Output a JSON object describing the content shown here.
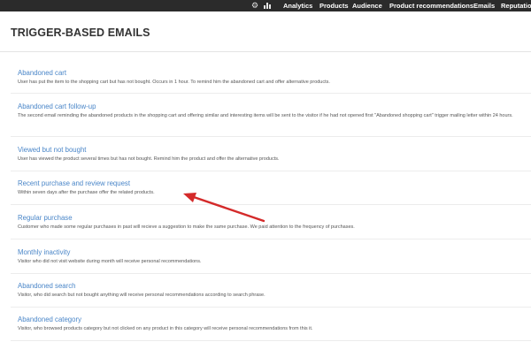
{
  "topbar": {
    "icons": [
      "gear-icon",
      "bar-chart-icon"
    ],
    "nav": [
      "Analytics",
      "Products",
      "Audience",
      "Product recommendations",
      "Emails",
      "Reputation"
    ]
  },
  "page": {
    "title": "TRIGGER-BASED EMAILS"
  },
  "items": [
    {
      "title": "Abandoned cart",
      "description": "User has put the item to the shopping cart but has not bought. Occurs in 1 hour. To remind him the abandoned cart and offer alternative products."
    },
    {
      "title": "Abandoned cart follow-up",
      "description": "The second email reminding the abandoned products in the shopping cart and offering similar and interesting items will be sent to the visitor if he had not opened first \"Abandoned shopping cart\" trigger mailing letter within 24 hours."
    },
    {
      "title": "Viewed but not bought",
      "description": "User has viewed the product several times but has not bought. Remind him the product and offer the alternative products."
    },
    {
      "title": "Recent purchase and review request",
      "description": "Within seven days after the purchase offer the related products."
    },
    {
      "title": "Regular purchase",
      "description": "Customer who made some regular purchases in past will recieve a suggestion to make the same purchase. We paid attention to the frequency of purchases."
    },
    {
      "title": "Monthly inactivity",
      "description": "Visitor who did not visit website during month will receive personal recommendations."
    },
    {
      "title": "Abandoned search",
      "description": "Visitor, who did search but not bought anything will receive personal recommendations according to search phrase."
    },
    {
      "title": "Abandoned category",
      "description": "Visitor, who browsed products category but not clicked on any product in this category will receive personal recommendations from this it."
    }
  ],
  "annotation": {
    "color": "#d42a2a"
  }
}
